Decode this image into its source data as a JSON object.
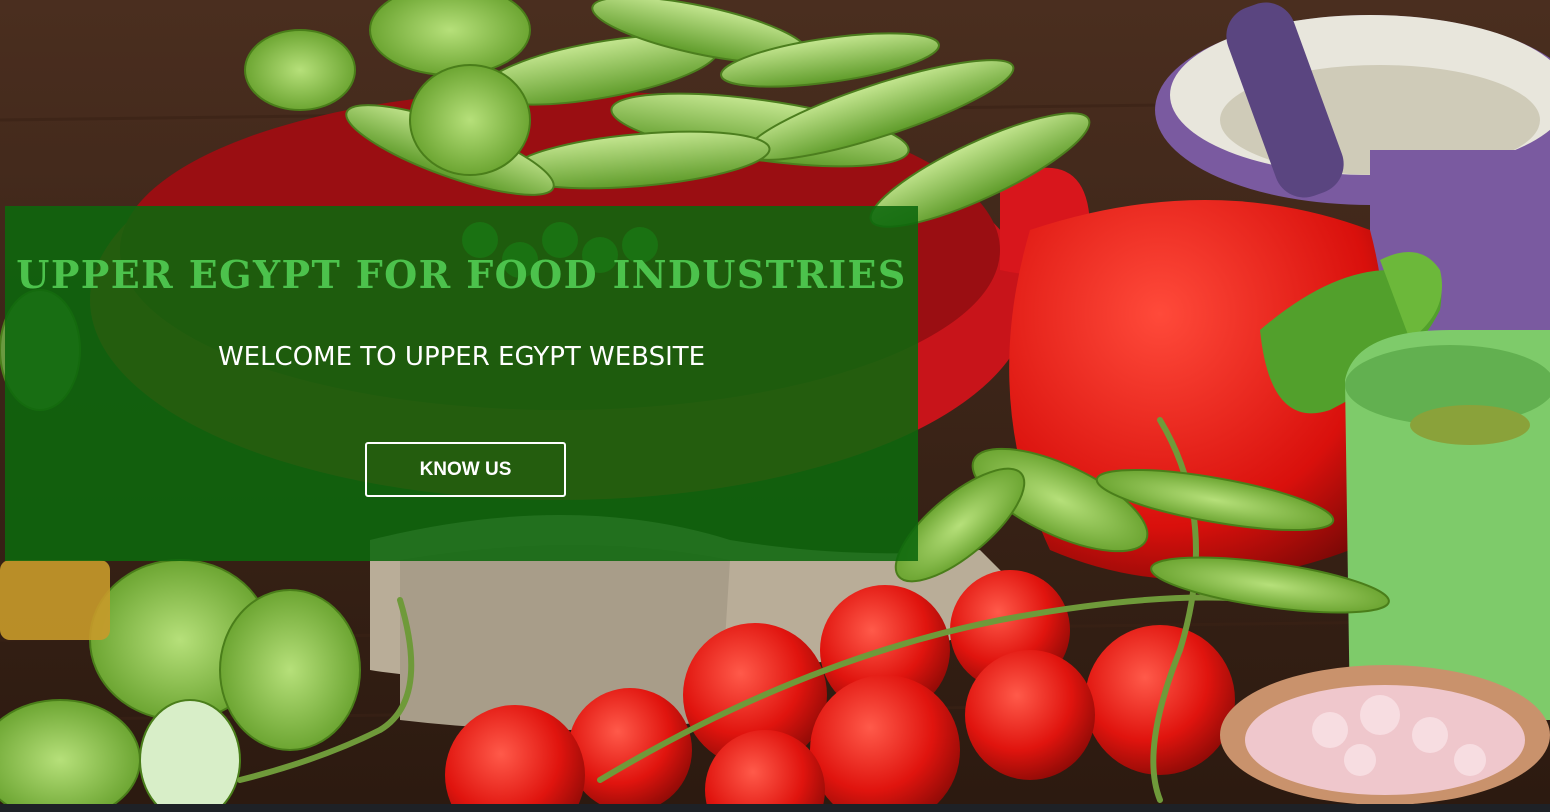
{
  "hero": {
    "title": "UPPER EGYPT FOR FOOD INDUSTRIES",
    "subtitle": "WELCOME TO UPPER EGYPT WEBSITE",
    "button_label": "KNOW US"
  },
  "colors": {
    "overlay": "#0c680c",
    "title": "#4cc24c",
    "text": "#ffffff",
    "footer": "#1e2126"
  }
}
